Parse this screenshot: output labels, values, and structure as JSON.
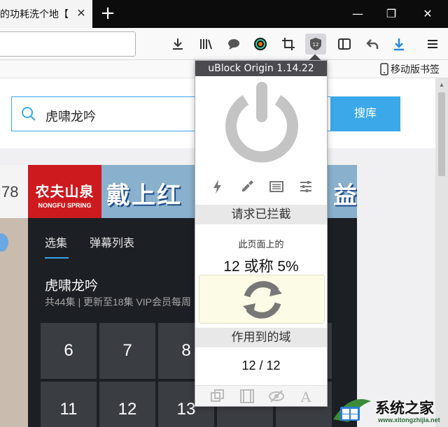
{
  "tab": {
    "title": "的功耗洗个地【",
    "close": "✕"
  },
  "window": {
    "new_tab": "+",
    "minimize": "—",
    "restore": "❐",
    "close": "✕"
  },
  "toolbar": {
    "icons": [
      "download-icon",
      "library-icon",
      "chat-icon",
      "color-icon",
      "crop-icon",
      "ublock-icon",
      "sidebar-icon",
      "back-icon",
      "download-arrow-icon",
      "menu-icon"
    ]
  },
  "bookmarks": {
    "mobile": "移动版书签"
  },
  "page": {
    "search": {
      "value": "虎啸龙吟",
      "button": "搜库"
    },
    "left_num": "78",
    "banner": {
      "logo_cn": "农夫山泉",
      "logo_en": "NONGFU SPRING",
      "slogan": "戴上红",
      "slogan_end": "益"
    },
    "player": {
      "tabs": [
        "选集",
        "弹幕列表"
      ],
      "title": "虎啸龙吟",
      "subtitle": "共44集 | 更新至18集 VIP会员每周",
      "episodes": [
        "6",
        "7",
        "8",
        "11",
        "12",
        "13"
      ]
    }
  },
  "ublock": {
    "header": "uBlock Origin 1.14.22",
    "blocked_heading": "请求已拦截",
    "on_this_page": "此页面上的",
    "blocked_stat": "12 或称 5%",
    "domains_heading": "作用到的域",
    "domains_stat": "12 / 12",
    "colors": {
      "power": "#c4c4c4",
      "header_bg": "#4a4a4f",
      "refresh_bg": "#fbfbe6"
    }
  },
  "watermark": {
    "text": "系统之家",
    "url": "www.xitongzhijia.net"
  }
}
